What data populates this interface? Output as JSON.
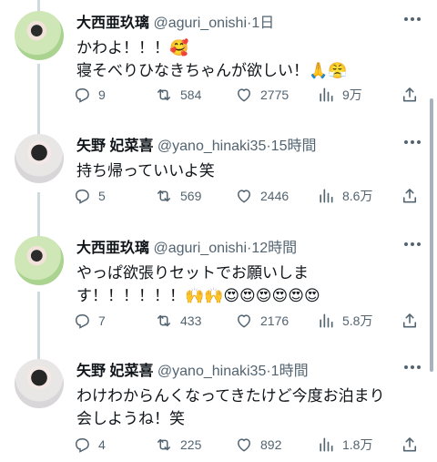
{
  "tweets": [
    {
      "name": "大西亜玖璃",
      "handle": "@aguri_onishi",
      "time": "1日",
      "line1": "かわよ！！！🥰",
      "line2": "寝そべりひなきちゃんが欲しい！🙏😤",
      "replies": "9",
      "retweets": "584",
      "likes": "2775",
      "views": "9万"
    },
    {
      "name": "矢野 妃菜喜",
      "handle": "@yano_hinaki35",
      "time": "15時間",
      "line1": "持ち帰っていいよ笑",
      "line2": "",
      "replies": "5",
      "retweets": "569",
      "likes": "2446",
      "views": "8.6万"
    },
    {
      "name": "大西亜玖璃",
      "handle": "@aguri_onishi",
      "time": "12時間",
      "line1": "やっぱ欲張りセットでお願いしま",
      "line2": "す！！！！！！🙌🙌😍😍😍😍😍😍",
      "replies": "7",
      "retweets": "433",
      "likes": "2176",
      "views": "5.8万"
    },
    {
      "name": "矢野 妃菜喜",
      "handle": "@yano_hinaki35",
      "time": "1時間",
      "line1": "わけわからんくなってきたけど今度お泊まり",
      "line2": "会しようね！笑",
      "replies": "4",
      "retweets": "225",
      "likes": "892",
      "views": "1.8万"
    }
  ],
  "icons": {
    "reply": "reply-icon",
    "retweet": "retweet-icon",
    "like": "like-icon",
    "views": "views-icon",
    "share": "share-icon",
    "more": "more-icon"
  },
  "colors": {
    "text": "#0f1419",
    "muted": "#536471",
    "thread_line": "#cfd9de"
  }
}
